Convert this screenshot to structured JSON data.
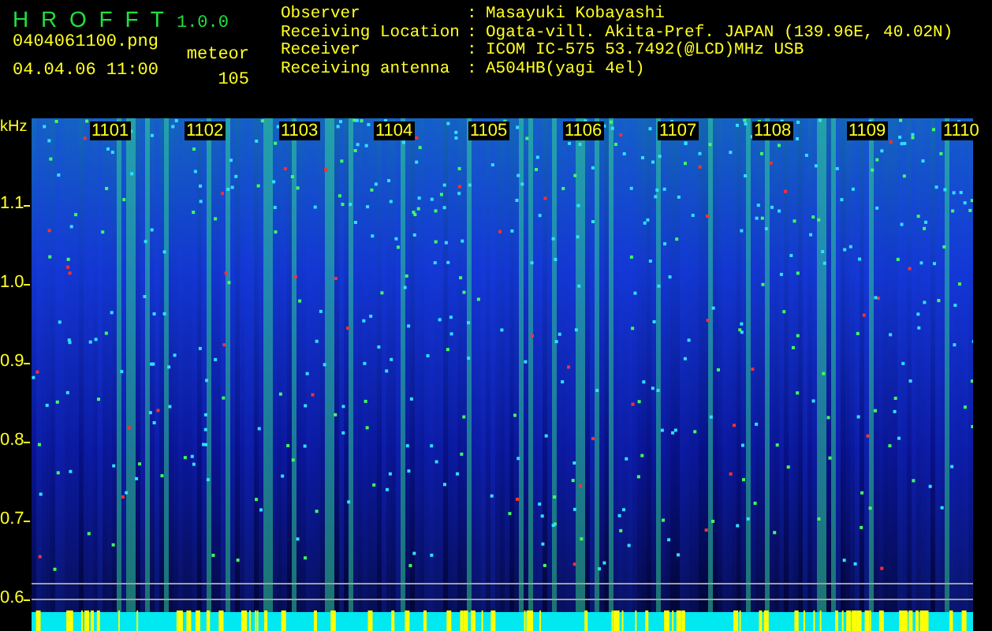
{
  "header": {
    "app_name": "H R O F F T",
    "version": "1.0.0",
    "file": "0404061100.png",
    "datetime": "04.04.06 11:00",
    "mode": "meteor",
    "count": "105"
  },
  "info": [
    {
      "label": "Observer",
      "separator": ":",
      "value": "Masayuki Kobayashi"
    },
    {
      "label": "Receiving Location",
      "separator": ":",
      "value": "Ogata-vill. Akita-Pref. JAPAN (139.96E, 40.02N)"
    },
    {
      "label": "Receiver",
      "separator": ":",
      "value": "ICOM IC-575 53.7492(@LCD)MHz USB"
    },
    {
      "label": "Receiving antenna",
      "separator": ":",
      "value": "A504HB(yagi 4el)"
    }
  ],
  "spectrogram": {
    "unit": "kHz",
    "y_labels": [
      "1.1",
      "1.0",
      "0.9",
      "0.8",
      "0.7",
      "0.6"
    ],
    "time_labels": [
      "1101",
      "1102",
      "1103",
      "1104",
      "1105",
      "1106",
      "1107",
      "1108",
      "1109",
      "1110"
    ]
  }
}
